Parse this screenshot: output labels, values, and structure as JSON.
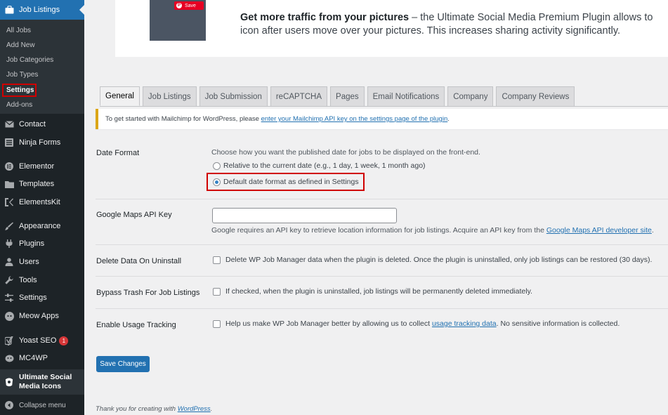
{
  "sidebar": {
    "current_menu": "Job Listings",
    "submenu": [
      "All Jobs",
      "Add New",
      "Job Categories",
      "Job Types",
      "Settings",
      "Add-ons"
    ],
    "items": [
      {
        "label": "Contact",
        "icon": "mail-icon"
      },
      {
        "label": "Ninja Forms",
        "icon": "forms-icon"
      },
      {
        "label": "Elementor",
        "icon": "elementor-icon"
      },
      {
        "label": "Templates",
        "icon": "folder-icon"
      },
      {
        "label": "ElementsKit",
        "icon": "elementskit-icon"
      },
      {
        "label": "Appearance",
        "icon": "brush-icon"
      },
      {
        "label": "Plugins",
        "icon": "plug-icon"
      },
      {
        "label": "Users",
        "icon": "user-icon"
      },
      {
        "label": "Tools",
        "icon": "wrench-icon"
      },
      {
        "label": "Settings",
        "icon": "sliders-icon"
      },
      {
        "label": "Meow Apps",
        "icon": "meow-icon"
      },
      {
        "label": "Yoast SEO",
        "icon": "yoast-icon",
        "badge": "1"
      },
      {
        "label": "MC4WP",
        "icon": "mc4wp-icon"
      }
    ],
    "usmi_label_1": "Ultimate Social",
    "usmi_label_2": "Media Icons",
    "collapse": "Collapse menu"
  },
  "promo": {
    "pin_label": "Save",
    "headline": "Get more traffic from your pictures",
    "text_1": " – the Ultimate Social Media Premium Plugin allows to",
    "text_2": "icon after users move over your pictures. This increases sharing activity significantly."
  },
  "tabs": [
    "General",
    "Job Listings",
    "Job Submission",
    "reCAPTCHA",
    "Pages",
    "Email Notifications",
    "Company",
    "Company Reviews"
  ],
  "notice": {
    "text": "To get started with Mailchimp for WordPress, please ",
    "link": "enter your Mailchimp API key on the settings page of the plugin",
    "end": "."
  },
  "settings": {
    "date_format": {
      "label": "Date Format",
      "desc": "Choose how you want the published date for jobs to be displayed on the front-end.",
      "option_relative": "Relative to the current date (e.g., 1 day, 1 week, 1 month ago)",
      "option_default": "Default date format as defined in Settings",
      "selected": "default"
    },
    "google_maps": {
      "label": "Google Maps API Key",
      "value": "",
      "desc": "Google requires an API key to retrieve location information for job listings. Acquire an API key from the ",
      "link": "Google Maps API developer site",
      "end": "."
    },
    "delete_data": {
      "label": "Delete Data On Uninstall",
      "desc": "Delete WP Job Manager data when the plugin is deleted. Once the plugin is uninstalled, only job listings can be restored (30 days)."
    },
    "bypass_trash": {
      "label": "Bypass Trash For Job Listings",
      "desc": "If checked, when the plugin is uninstalled, job listings will be permanently deleted immediately."
    },
    "usage_tracking": {
      "label": "Enable Usage Tracking",
      "desc_1": "Help us make WP Job Manager better by allowing us to collect ",
      "link": "usage tracking data",
      "desc_2": ". No sensitive information is collected."
    }
  },
  "save_button": "Save Changes",
  "footer": {
    "text": "Thank you for creating with ",
    "link": "WordPress",
    "end": "."
  },
  "colors": {
    "sidebar_bg": "#1d2327",
    "submenu_bg": "#2c3338",
    "accent": "#2271b1",
    "highlight_box": "#d00000",
    "notice_border": "#dba617"
  }
}
